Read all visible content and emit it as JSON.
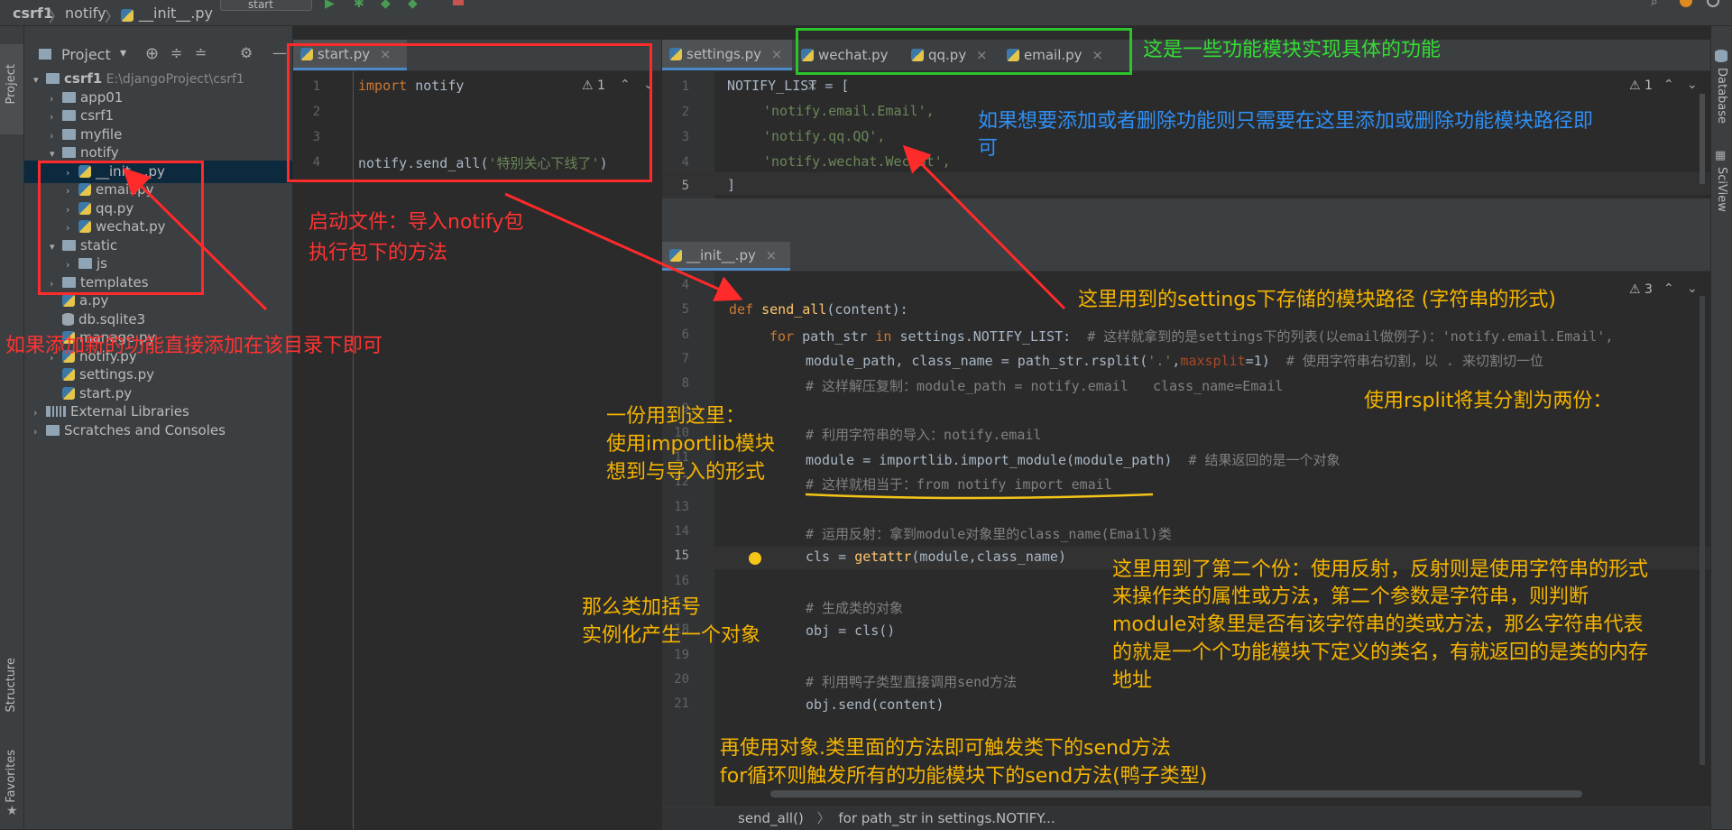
{
  "topbar": {
    "project": "csrf1",
    "sep1": "〉",
    "folder": "notify",
    "sep2": "〉",
    "file": "__init__.py",
    "run_config": "start"
  },
  "left_strip": {
    "project_label": "Project",
    "structure_label": "Structure",
    "favorites_label": "Favorites"
  },
  "right_strip": {
    "database_label": "Database",
    "sciview_label": "SciView"
  },
  "project_panel": {
    "title": "Project",
    "dropdown": "▾",
    "tree": [
      {
        "label": "csrf1",
        "extra": "E:\\djangoProject\\csrf1",
        "arrow": "▾",
        "icon": "folder"
      },
      {
        "label": "app01",
        "arrow": "›",
        "icon": "folder"
      },
      {
        "label": "csrf1",
        "arrow": "›",
        "icon": "folder"
      },
      {
        "label": "myfile",
        "arrow": "›",
        "icon": "folder"
      },
      {
        "label": "notify",
        "arrow": "▾",
        "icon": "folder"
      },
      {
        "label": "__init__.py",
        "arrow": "›",
        "icon": "py"
      },
      {
        "label": "email.py",
        "arrow": "›",
        "icon": "py"
      },
      {
        "label": "qq.py",
        "arrow": "›",
        "icon": "py"
      },
      {
        "label": "wechat.py",
        "arrow": "›",
        "icon": "py"
      },
      {
        "label": "static",
        "arrow": "▾",
        "icon": "folder"
      },
      {
        "label": "js",
        "arrow": "›",
        "icon": "folder"
      },
      {
        "label": "templates",
        "arrow": "›",
        "icon": "folder"
      },
      {
        "label": "a.py",
        "arrow": "",
        "icon": "py"
      },
      {
        "label": "db.sqlite3",
        "arrow": "",
        "icon": "db"
      },
      {
        "label": "manage.py",
        "arrow": "",
        "icon": "py"
      },
      {
        "label": "notify.py",
        "arrow": "›",
        "icon": "py"
      },
      {
        "label": "settings.py",
        "arrow": "",
        "icon": "py"
      },
      {
        "label": "start.py",
        "arrow": "",
        "icon": "py"
      },
      {
        "label": "External Libraries",
        "arrow": "›",
        "icon": "lib"
      },
      {
        "label": "Scratches and Consoles",
        "arrow": "›",
        "icon": "scratch"
      }
    ]
  },
  "editor1": {
    "tab": "start.py",
    "warning": "⚠ 1",
    "lines": [
      {
        "n": "1",
        "kw": "import",
        "rest": " notify"
      },
      {
        "n": "2"
      },
      {
        "n": "3"
      },
      {
        "n": "4",
        "pre": "notify.send_all(",
        "str": "'特别关心下线了'",
        "post": ")"
      }
    ]
  },
  "editor2": {
    "tabs": [
      "settings.py",
      "wechat.py",
      "qq.py",
      "email.py"
    ],
    "warning": "⚠ 1",
    "lines": [
      {
        "n": "1",
        "text": "NOTIFY_LIST = ["
      },
      {
        "n": "2",
        "str": "'notify.email.Email',"
      },
      {
        "n": "3",
        "str": "'notify.qq.QQ',"
      },
      {
        "n": "4",
        "str": "'notify.wechat.Wechat',"
      },
      {
        "n": "5",
        "text": "]"
      }
    ]
  },
  "editor3": {
    "tab": "__init__.py",
    "warning": "⚠ 3",
    "line_numbers": [
      "4",
      "5",
      "6",
      "7",
      "8",
      "9",
      "10",
      "11",
      "12",
      "13",
      "14",
      "15",
      "16",
      "17",
      "18",
      "19",
      "20",
      "21"
    ],
    "def_kw": "def",
    "def_name": "send_all",
    "def_rest": "(content):",
    "for_kw": "for",
    "for_var": " path_str ",
    "in_kw": "in",
    "for_rest": " settings.NOTIFY_LIST:",
    "for_comment": "  # 这样就拿到的是settings下的列表(以email做例子)：'notify.email.Email',",
    "l7_a": "module_path, class_name = path_str.rsplit(",
    "l7_str": "'.'",
    "l7_b": ",",
    "l7_param": "maxsplit",
    "l7_c": "=1)",
    "l7_comment": "  # 使用字符串右切割，以 . 来切割切一位",
    "l8_comment": "# 这样解压复制：module_path = notify.email   class_name=Email",
    "l10_comment": "# 利用字符串的导入：notify.email",
    "l11_code": "module = importlib.import_module(module_path)",
    "l11_comment": "  # 结果返回的是一个对象",
    "l12_comment": "# 这样就相当于：from notify import email",
    "l14_comment": "# 运用反射：拿到module对象里的class_name(Email)类",
    "l15_a": "cls = ",
    "l15_fn": "getattr",
    "l15_b": "(module,class_name)",
    "l17_comment": "# 生成类的对象",
    "l18_code": "obj = cls()",
    "l20_comment": "# 利用鸭子类型直接调用send方法",
    "l21_code": "obj.send(content)"
  },
  "bottom_breadcrumb": {
    "a": "send_all()",
    "sep": "〉",
    "b": "for path_str in settings.NOTIFY..."
  },
  "annotations": {
    "green_note": "这是一些功能模块实现具体的功能",
    "blue_note_1": "如果想要添加或者删除功能则只需要在这里添加或删除功能模块路径即",
    "blue_note_2": "可",
    "red_start_1": "启动文件：导入notify包",
    "red_start_2": "执行包下的方法",
    "red_add": "如果添加新的功能直接添加在该目录下即可",
    "y_settings_path": "这里用到的settings下存储的模块路径 (字符串的形式)",
    "y_rsplit": "使用rsplit将其分割为两份：",
    "y_importlib_1": "一份用到这里：",
    "y_importlib_2": "使用importlib模块",
    "y_importlib_3": "想到与导入的形式",
    "y_reflect_1": "这里用到了第二个份：使用反射，反射则是使用字符串的形式",
    "y_reflect_2": "来操作类的属性或方法，第二个参数是字符串，则判断",
    "y_reflect_3": "module对象里是否有该字符串的类或方法，那么字符串代表",
    "y_reflect_4": "的就是一个个功能模块下定义的类名，有就返回的是类的内存",
    "y_reflect_5": "地址",
    "y_class_1": "那么类加括号",
    "y_class_2": "实例化产生一个对象",
    "y_send_1": "再使用对象.类里面的方法即可触发类下的send方法",
    "y_send_2": "for循环则触发所有的功能模块下的send方法(鸭子类型)"
  },
  "colors": {
    "red": "#ff2a2a",
    "green": "#2bc42b",
    "blue": "#2f8ff5",
    "yellow": "#f5b400",
    "editor_bg": "#2b2b2b",
    "panel_bg": "#3c3f41"
  }
}
